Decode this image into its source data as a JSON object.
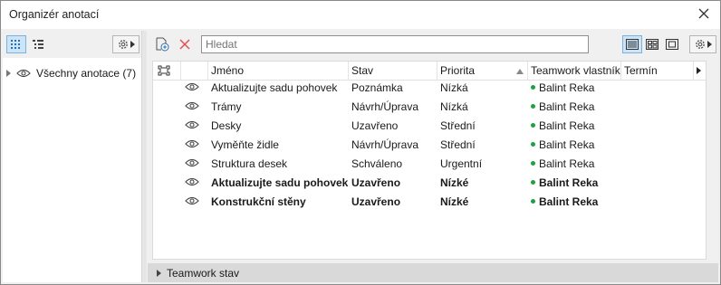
{
  "window": {
    "title": "Organizér anotací"
  },
  "left": {
    "tree": [
      {
        "label": "Všechny anotace (7)"
      }
    ]
  },
  "search": {
    "placeholder": "Hledat",
    "value": ""
  },
  "columns": {
    "name": "Jméno",
    "status": "Stav",
    "priority": "Priorita",
    "owner": "Teamwork vlastník",
    "due": "Termín"
  },
  "rows": [
    {
      "name": "Aktualizujte sadu pohovek",
      "status": "Poznámka",
      "priority": "Nízká",
      "owner": "Balint Reka",
      "bold": false
    },
    {
      "name": "Trámy",
      "status": "Návrh/Úprava",
      "priority": "Nízká",
      "owner": "Balint Reka",
      "bold": false
    },
    {
      "name": "Desky",
      "status": "Uzavřeno",
      "priority": "Střední",
      "owner": "Balint Reka",
      "bold": false
    },
    {
      "name": "Vyměňte židle",
      "status": "Návrh/Úprava",
      "priority": "Střední",
      "owner": "Balint Reka",
      "bold": false
    },
    {
      "name": "Struktura desek",
      "status": "Schváleno",
      "priority": "Urgentní",
      "owner": "Balint Reka",
      "bold": false
    },
    {
      "name": "Aktualizujte sadu pohovek",
      "status": "Uzavřeno",
      "priority": "Nízké",
      "owner": "Balint Reka",
      "bold": true
    },
    {
      "name": "Konstrukční stěny",
      "status": "Uzavřeno",
      "priority": "Nízké",
      "owner": "Balint Reka",
      "bold": true
    }
  ],
  "bottom": {
    "teamwork_label": "Teamwork stav"
  },
  "colors": {
    "selected_bg": "#cce4f7",
    "selected_border": "#7ab1dd",
    "owner_dot": "#20a040",
    "delete_red": "#e05050"
  }
}
